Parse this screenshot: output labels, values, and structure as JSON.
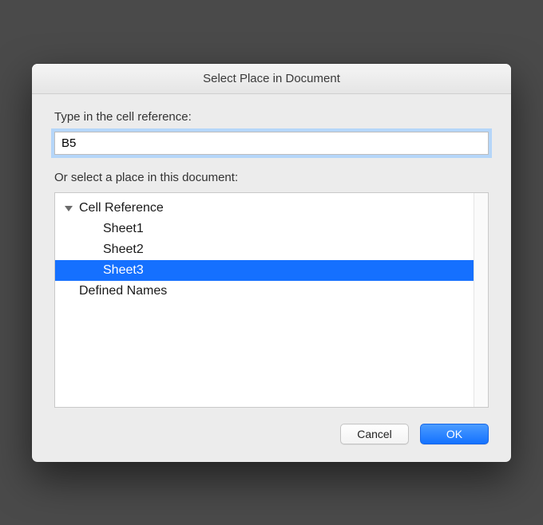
{
  "dialog": {
    "title": "Select Place in Document",
    "cell_ref_label": "Type in the cell reference:",
    "cell_ref_value": "B5",
    "place_label": "Or select a place in this document:",
    "tree": {
      "root": {
        "label": "Cell Reference",
        "expanded": true
      },
      "children": [
        {
          "label": "Sheet1",
          "selected": false
        },
        {
          "label": "Sheet2",
          "selected": false
        },
        {
          "label": "Sheet3",
          "selected": true
        }
      ],
      "sibling": {
        "label": "Defined Names"
      }
    },
    "buttons": {
      "cancel": "Cancel",
      "ok": "OK"
    }
  }
}
